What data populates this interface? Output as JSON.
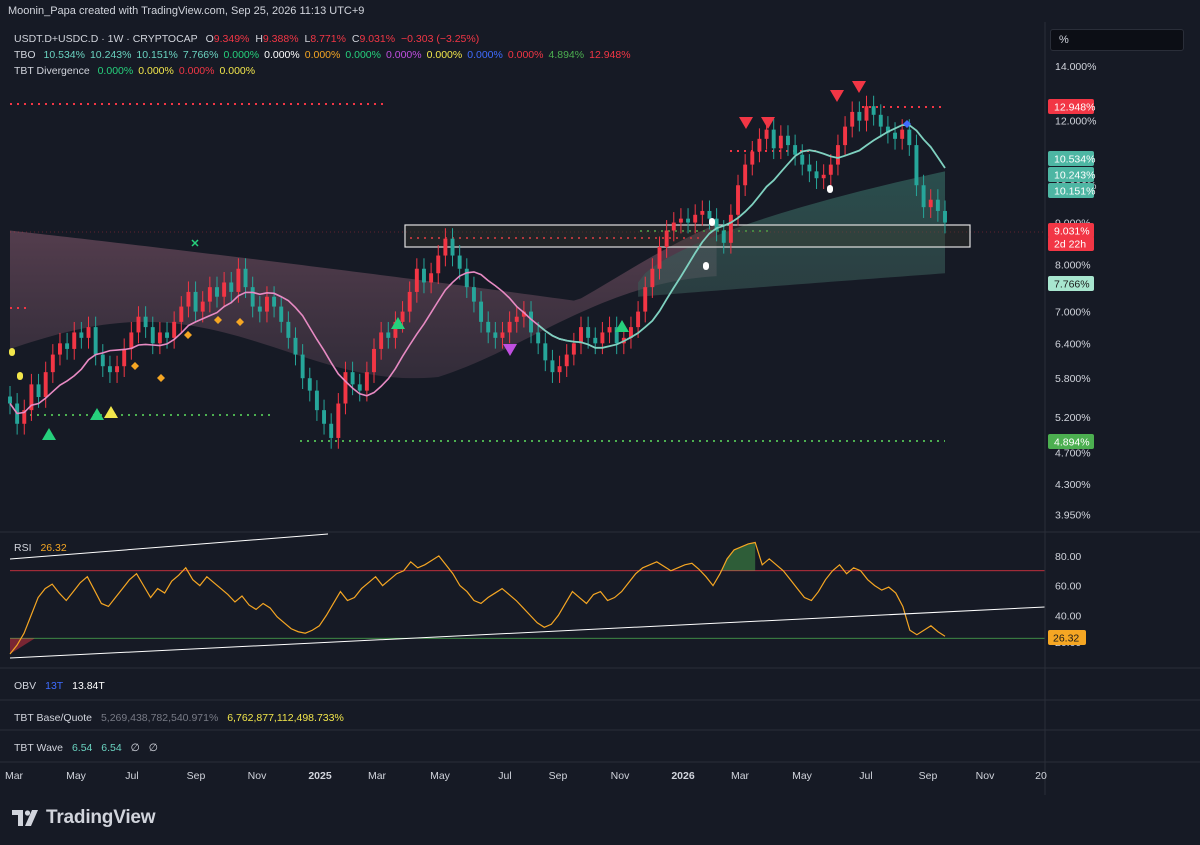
{
  "header": {
    "attribution": "Moonin_Papa created with TradingView.com, Sep 25, 2026 11:13 UTC+9"
  },
  "legend": {
    "symbol": "USDT.D+USDC.D · 1W · CRYPTOCAP",
    "open_label": "O",
    "open": "9.349%",
    "high_label": "H",
    "high": "9.388%",
    "low_label": "L",
    "low": "8.771%",
    "close_label": "C",
    "close": "9.031%",
    "change": "−0.303 (−3.25%)",
    "tbo_name": "TBO",
    "tbo_values": [
      {
        "v": "10.534%",
        "c": "#6ad3c0"
      },
      {
        "v": "10.243%",
        "c": "#6ad3c0"
      },
      {
        "v": "10.151%",
        "c": "#6ad3c0"
      },
      {
        "v": "7.766%",
        "c": "#6ad3c0"
      },
      {
        "v": "0.000%",
        "c": "#26d07c"
      },
      {
        "v": "0.000%",
        "c": "#ffffff"
      },
      {
        "v": "0.000%",
        "c": "#f5a623"
      },
      {
        "v": "0.000%",
        "c": "#26d07c"
      },
      {
        "v": "0.000%",
        "c": "#c04fe0"
      },
      {
        "v": "0.000%",
        "c": "#f2e64b"
      },
      {
        "v": "0.000%",
        "c": "#3f6cff"
      },
      {
        "v": "0.000%",
        "c": "#f23645"
      },
      {
        "v": "4.894%",
        "c": "#4caf50"
      },
      {
        "v": "12.948%",
        "c": "#f23645"
      }
    ],
    "tbt_div_name": "TBT Divergence",
    "tbt_div_values": [
      {
        "v": "0.000%",
        "c": "#26d07c"
      },
      {
        "v": "0.000%",
        "c": "#f2e64b"
      },
      {
        "v": "0.000%",
        "c": "#f23645"
      },
      {
        "v": "0.000%",
        "c": "#f2e64b"
      }
    ]
  },
  "scale_box": {
    "label": "%"
  },
  "price_axis": {
    "ticks": [
      "14.000%",
      "12.000%",
      "10.000%",
      "9.000%",
      "8.000%",
      "7.000%",
      "6.400%",
      "5.800%",
      "5.200%",
      "4.700%",
      "4.300%",
      "3.950%"
    ],
    "badges": [
      {
        "text": "12.948%",
        "bg": "#f23645",
        "fg": "#ffffff"
      },
      {
        "text": "10.534%",
        "bg": "#4db6a3",
        "fg": "#ffffff"
      },
      {
        "text": "10.243%",
        "bg": "#4db6a3",
        "fg": "#ffffff"
      },
      {
        "text": "10.151%",
        "bg": "#4db6a3",
        "fg": "#ffffff"
      },
      {
        "text": "9.031%",
        "bg": "#f23645",
        "fg": "#ffffff"
      },
      {
        "text": "2d 22h",
        "bg": "#f23645",
        "fg": "#ffffff"
      },
      {
        "text": "7.766%",
        "bg": "#a8e6cf",
        "fg": "#1a1a1a"
      },
      {
        "text": "4.894%",
        "bg": "#4caf50",
        "fg": "#ffffff"
      }
    ]
  },
  "rsi": {
    "name": "RSI",
    "value": "26.32",
    "ticks": [
      "80.00",
      "60.00",
      "40.00",
      "20.00"
    ],
    "badge": "26.32",
    "overbought": 70,
    "oversold": 30,
    "ymin": 10,
    "ymax": 90
  },
  "obv": {
    "name": "OBV",
    "tag": "13T",
    "value": "13.84T"
  },
  "tbt_bq": {
    "name": "TBT Base/Quote",
    "v1": "5,269,438,782,540.971%",
    "v2": "6,762,877,112,498.733%"
  },
  "tbt_wave": {
    "name": "TBT Wave",
    "v1": "6.54",
    "v2": "6.54",
    "v3": "∅",
    "v4": "∅"
  },
  "time_axis": {
    "ticks": [
      "Mar",
      "May",
      "Jul",
      "Sep",
      "Nov",
      "2025",
      "Mar",
      "May",
      "Jul",
      "Sep",
      "Nov",
      "2026",
      "Mar",
      "May",
      "Jul",
      "Sep",
      "Nov",
      "20"
    ]
  },
  "brand": {
    "name": "TradingView"
  },
  "colors": {
    "up": "#26a69a",
    "down": "#f23645",
    "rsi": "#f5a623",
    "ma": "#7fd1c0",
    "pinkma": "#e78ac3"
  },
  "chart_data": {
    "type": "candlestick",
    "scale": "log",
    "ylim": [
      3.8,
      15.5
    ],
    "x_start": "2024-03",
    "x_end": "2026-11",
    "closes": [
      5.4,
      5.1,
      5.3,
      5.7,
      5.5,
      5.9,
      6.2,
      6.4,
      6.3,
      6.6,
      6.5,
      6.7,
      6.2,
      6.0,
      5.9,
      6.0,
      6.3,
      6.6,
      6.9,
      6.7,
      6.4,
      6.6,
      6.5,
      6.8,
      7.1,
      7.4,
      7.0,
      7.2,
      7.5,
      7.3,
      7.6,
      7.4,
      7.9,
      7.5,
      7.1,
      7.0,
      7.3,
      7.1,
      6.8,
      6.5,
      6.2,
      5.8,
      5.6,
      5.3,
      5.1,
      4.9,
      5.4,
      5.9,
      5.7,
      5.6,
      5.9,
      6.3,
      6.6,
      6.5,
      6.8,
      7.0,
      7.4,
      7.9,
      7.6,
      7.8,
      8.2,
      8.6,
      8.2,
      7.9,
      7.5,
      7.2,
      6.8,
      6.6,
      6.5,
      6.6,
      6.8,
      6.9,
      7.0,
      6.6,
      6.4,
      6.1,
      5.9,
      6.0,
      6.2,
      6.4,
      6.7,
      6.5,
      6.4,
      6.6,
      6.7,
      6.4,
      6.5,
      6.7,
      7.0,
      7.5,
      7.9,
      8.4,
      8.8,
      9.0,
      9.1,
      9.0,
      9.2,
      9.3,
      9.1,
      8.8,
      8.5,
      9.2,
      10.0,
      10.6,
      11.0,
      11.4,
      11.7,
      11.1,
      11.5,
      11.2,
      10.9,
      10.6,
      10.4,
      10.2,
      10.3,
      10.6,
      11.2,
      11.8,
      12.3,
      12.0,
      12.5,
      12.2,
      11.8,
      11.6,
      11.4,
      11.7,
      11.2,
      10.0,
      9.4,
      9.6,
      9.3,
      9.0
    ],
    "rsi": [
      14,
      20,
      28,
      40,
      52,
      58,
      61,
      55,
      50,
      56,
      62,
      66,
      57,
      48,
      46,
      52,
      58,
      64,
      68,
      60,
      52,
      58,
      55,
      63,
      67,
      72,
      64,
      60,
      66,
      62,
      58,
      54,
      49,
      53,
      47,
      44,
      48,
      45,
      39,
      35,
      31,
      29,
      28,
      30,
      33,
      40,
      48,
      56,
      50,
      52,
      58,
      62,
      66,
      60,
      64,
      68,
      70,
      76,
      72,
      74,
      77,
      80,
      74,
      68,
      60,
      56,
      50,
      48,
      52,
      55,
      58,
      54,
      50,
      45,
      40,
      35,
      32,
      34,
      40,
      48,
      56,
      52,
      48,
      54,
      56,
      50,
      52,
      56,
      62,
      68,
      72,
      74,
      76,
      73,
      70,
      72,
      74,
      75,
      71,
      66,
      60,
      68,
      78,
      84,
      86,
      88,
      89,
      74,
      78,
      74,
      70,
      64,
      58,
      52,
      50,
      56,
      64,
      70,
      74,
      68,
      72,
      70,
      64,
      60,
      57,
      59,
      55,
      46,
      30,
      27,
      30,
      33,
      29,
      26
    ]
  }
}
